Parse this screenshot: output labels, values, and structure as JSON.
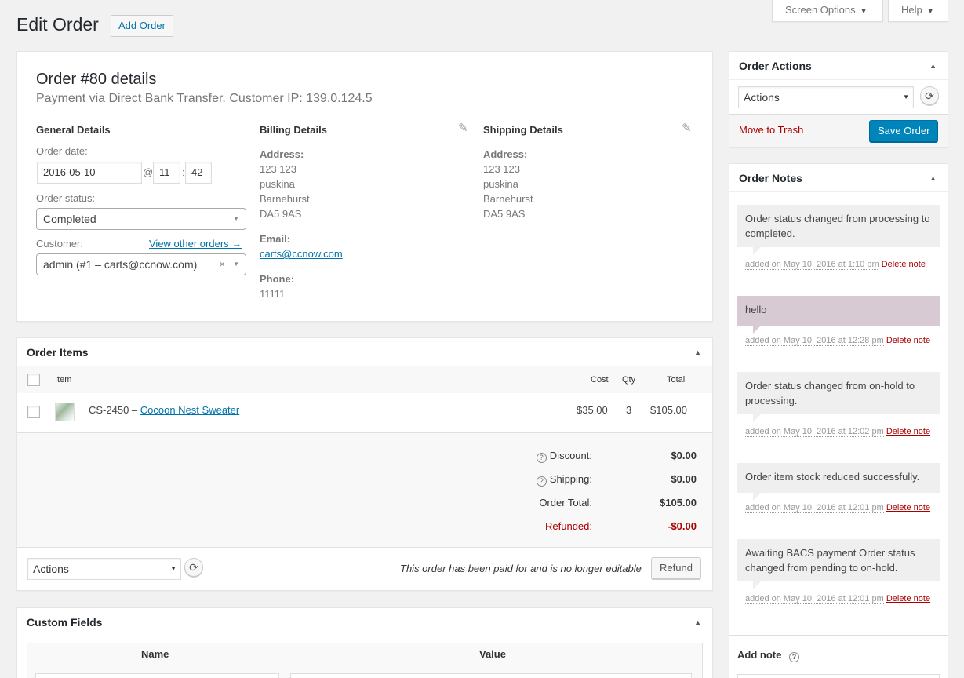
{
  "header": {
    "title": "Edit Order",
    "add_order": "Add Order",
    "screen_options": "Screen Options",
    "help": "Help"
  },
  "order": {
    "title": "Order #80 details",
    "subtitle": "Payment via Direct Bank Transfer. Customer IP: 139.0.124.5",
    "general_heading": "General Details",
    "date_label": "Order date:",
    "date": "2016-05-10",
    "at": "@",
    "hour": "11",
    "colon": ":",
    "minute": "42",
    "status_label": "Order status:",
    "status": "Completed",
    "customer_label": "Customer:",
    "view_other": "View other orders →",
    "customer": "admin (#1 – carts@ccnow.com)",
    "billing": {
      "heading": "Billing Details",
      "address_label": "Address:",
      "address": [
        "123 123",
        "puskina",
        "Barnehurst",
        "DA5 9AS"
      ],
      "email_label": "Email:",
      "email": "carts@ccnow.com",
      "phone_label": "Phone:",
      "phone": "11111"
    },
    "shipping": {
      "heading": "Shipping Details",
      "address_label": "Address:",
      "address": [
        "123 123",
        "puskina",
        "Barnehurst",
        "DA5 9AS"
      ]
    }
  },
  "items": {
    "heading": "Order Items",
    "col_item": "Item",
    "col_cost": "Cost",
    "col_qty": "Qty",
    "col_total": "Total",
    "rows": [
      {
        "sku": "CS-2450 – ",
        "name": "Cocoon Nest Sweater",
        "cost": "$35.00",
        "qty": "3",
        "total": "$105.00"
      }
    ],
    "totals": {
      "discount_label": "Discount:",
      "discount": "$0.00",
      "shipping_label": "Shipping:",
      "shipping": "$0.00",
      "total_label": "Order Total:",
      "total": "$105.00",
      "refunded_label": "Refunded:",
      "refunded": "-$0.00"
    },
    "actions": "Actions",
    "paid_note": "This order has been paid for and is no longer editable",
    "refund": "Refund"
  },
  "custom_fields": {
    "heading": "Custom Fields",
    "col_name": "Name",
    "col_value": "Value"
  },
  "order_actions": {
    "heading": "Order Actions",
    "select": "Actions",
    "trash": "Move to Trash",
    "save": "Save Order"
  },
  "notes": {
    "heading": "Order Notes",
    "delete_label": "Delete note",
    "list": [
      {
        "text": "Order status changed from processing to completed.",
        "meta": "added on May 10, 2016 at 1:10 pm"
      },
      {
        "text": "hello",
        "meta": "added on May 10, 2016 at 12:28 pm"
      },
      {
        "text": "Order status changed from on-hold to processing.",
        "meta": "added on May 10, 2016 at 12:02 pm"
      },
      {
        "text": "Order item stock reduced successfully.",
        "meta": "added on May 10, 2016 at 12:01 pm"
      },
      {
        "text": "Awaiting BACS payment Order status changed from pending to on-hold.",
        "meta": "added on May 10, 2016 at 12:01 pm"
      }
    ],
    "add_note": "Add note"
  },
  "colors": {
    "accent": "#0085ba",
    "link": "#0073aa",
    "danger": "#a00",
    "customer_note": "#d7cad2"
  }
}
